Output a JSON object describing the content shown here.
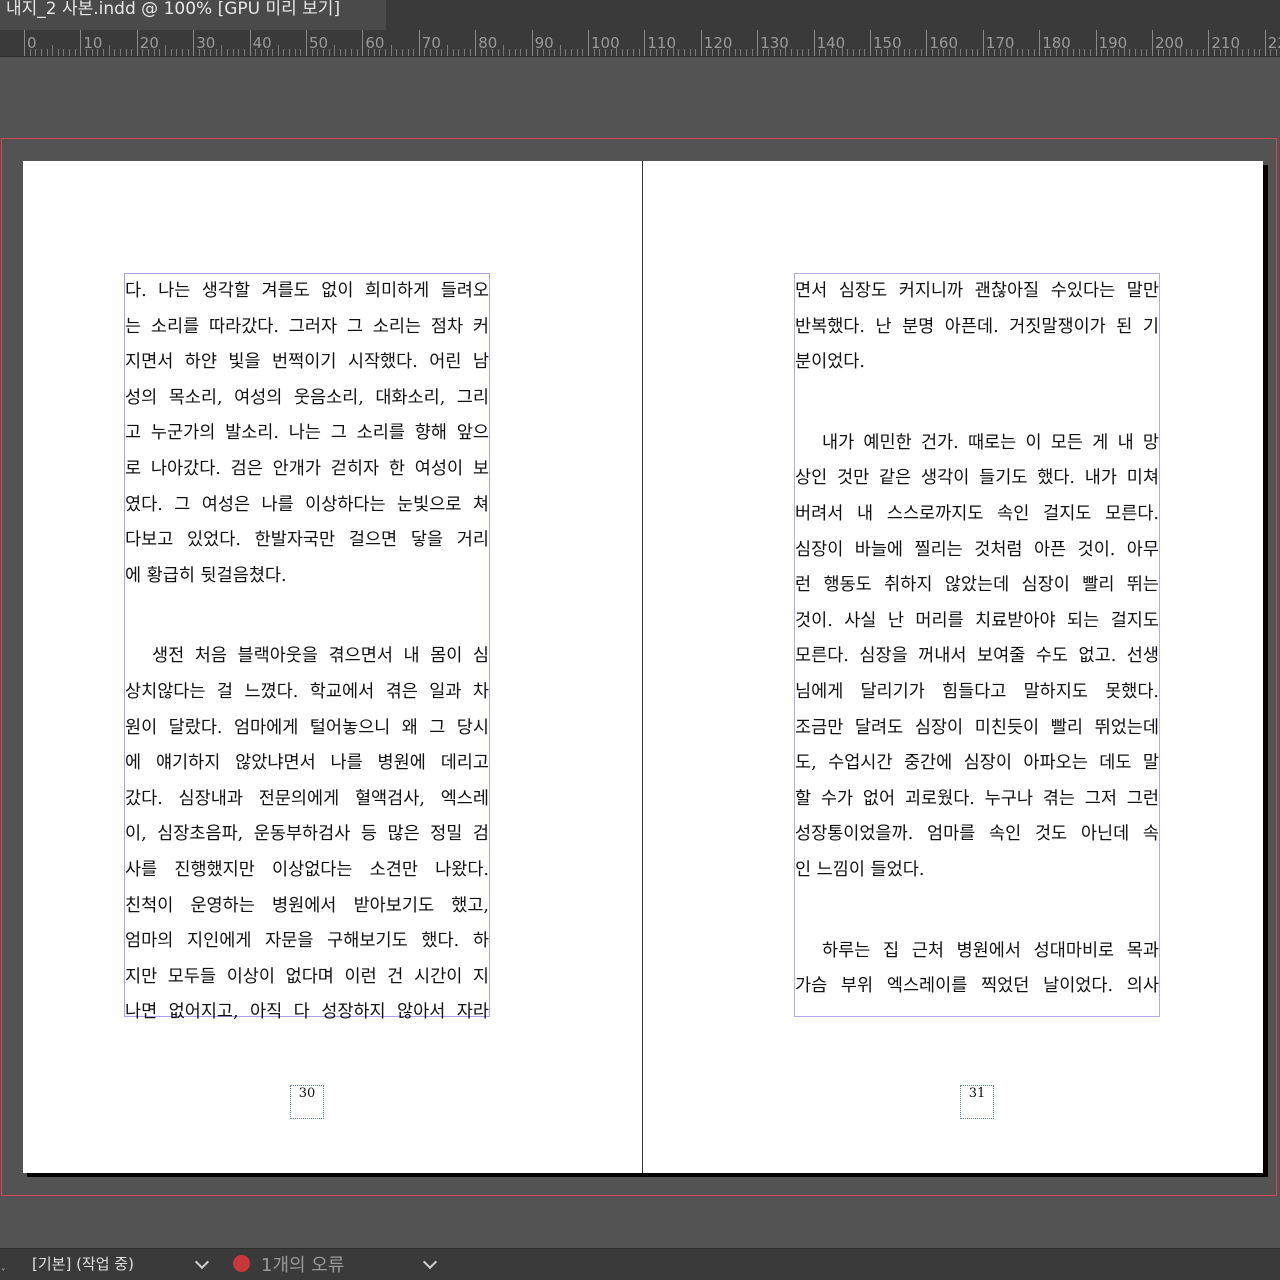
{
  "window": {
    "doc_tab_title": "내지_2 사본.indd @ 100% [GPU 미리 보기]"
  },
  "ruler": {
    "labels": [
      "0",
      "10",
      "20",
      "30",
      "40",
      "50",
      "60",
      "70",
      "80",
      "90",
      "100",
      "110",
      "120",
      "130",
      "140",
      "150",
      "160",
      "170",
      "180",
      "190",
      "200",
      "210",
      "22"
    ]
  },
  "pages": {
    "left": {
      "number": "30",
      "paragraph1": [
        "다. 나는 생각할 겨를도 없이 희미하게 들려오",
        "는 소리를 따라갔다. 그러자 그 소리는 점차 커",
        "지면서 하얀 빛을 번쩍이기 시작했다. 어린 남",
        "성의 목소리, 여성의 웃음소리, 대화소리, 그리",
        "고 누군가의 발소리. 나는 그 소리를 향해 앞으",
        "로 나아갔다. 검은 안개가 걷히자 한 여성이 보",
        "였다. 그 여성은 나를 이상하다는 눈빛으로 쳐",
        "다보고 있었다. 한발자국만 걸으면 닿을 거리",
        "에 황급히 뒷걸음쳤다."
      ],
      "paragraph2": [
        "생전 처음 블랙아웃을 겪으면서 내 몸이 심",
        "상치않다는 걸 느꼈다. 학교에서 겪은 일과 차",
        "원이 달랐다. 엄마에게 털어놓으니 왜 그 당시",
        "에 얘기하지 않았냐면서 나를 병원에 데리고",
        "갔다. 심장내과 전문의에게 혈액검사, 엑스레",
        "이, 심장초음파, 운동부하검사 등 많은 정밀 검",
        "사를 진행했지만 이상없다는 소견만 나왔다.",
        "친척이 운영하는 병원에서 받아보기도 했고,",
        "엄마의 지인에게 자문을 구해보기도 했다. 하",
        "지만 모두들 이상이 없다며 이런 건 시간이 지",
        "나면 없어지고, 아직 다 성장하지 않아서 자라"
      ]
    },
    "right": {
      "number": "31",
      "paragraph1": [
        "면서 심장도 커지니까 괜찮아질 수있다는 말만",
        "반복했다. 난 분명 아픈데. 거짓말쟁이가 된 기",
        "분이었다."
      ],
      "paragraph2": [
        "내가 예민한 건가. 때로는 이 모든 게 내 망",
        "상인 것만 같은 생각이 들기도 했다. 내가 미쳐",
        "버려서 내 스스로까지도 속인 걸지도 모른다.",
        "심장이 바늘에 찔리는 것처럼 아픈 것이. 아무",
        "런 행동도 취하지 않았는데 심장이 빨리 뛰는",
        "것이.  사실 난 머리를 치료받아야 되는 걸지도",
        "모른다. 심장을 꺼내서 보여줄 수도 없고. 선생",
        "님에게 달리기가 힘들다고 말하지도 못했다.",
        "조금만 달려도 심장이 미친듯이 빨리 뛰었는데",
        "도, 수업시간 중간에 심장이 아파오는 데도 말",
        "할 수가 없어 괴로웠다. 누구나 겪는 그저 그런",
        "성장통이었을까. 엄마를 속인 것도 아닌데 속",
        "인 느낌이 들었다."
      ],
      "paragraph3": [
        "하루는 집 근처 병원에서 성대마비로 목과",
        "가슴 부위 엑스레이를 찍었던 날이었다. 의사"
      ]
    }
  },
  "statusbar": {
    "preflight_profile": "[기본] (작업 중)",
    "error_count": "1개의 오류"
  },
  "colors": {
    "pasteboard": "#535353",
    "bleed_guide": "#d0485a",
    "text_frame": "#a9a0e6",
    "error": "#c9383c"
  }
}
